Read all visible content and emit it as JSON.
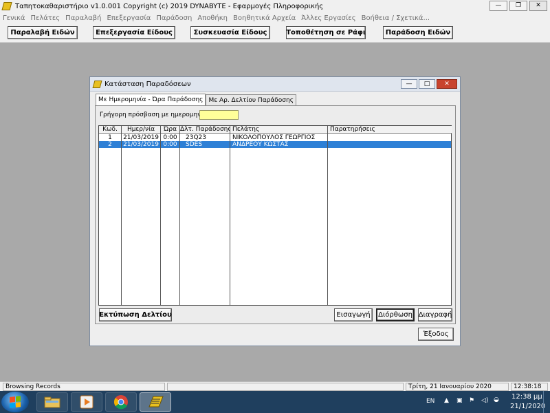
{
  "window": {
    "title": "Ταπητοκαθαριστήριο v1.0.001    Copyright (c) 2019  DYNABYTE - Εφαρμογές Πληροφορικής",
    "minimize": "—",
    "maximize": "❐",
    "close": "✕"
  },
  "menu": [
    "Γενικά",
    "Πελάτες",
    "Παραλαβή",
    "Επεξεργασία",
    "Παράδοση",
    "Αποθήκη",
    "Βοηθητικά Αρχεία",
    "Άλλες Εργασίες",
    "Βοήθεια / Σχετικά..."
  ],
  "toolbar": {
    "receive": "Παραλαβή Ειδών",
    "process": "Επεξεργασία Είδους",
    "package": "Συσκευασία Είδους",
    "shelve": "Τοποθέτηση σε Ράφι",
    "deliver": "Παράδοση Ειδών"
  },
  "dialog": {
    "title": "Κατάσταση Παραδόσεων",
    "minimize": "—",
    "maximize": "□",
    "close": "✕",
    "tabs": [
      "Με Ημερομηνία - Ώρα Παράδοσης",
      "Με Αρ. Δελτίου Παράδοσης"
    ],
    "quick_access_label": "Γρήγορη πρόσβαση με ημερομηνία :",
    "quick_access_value": "",
    "columns": [
      "Κωδ.",
      "Ημερ/νία",
      "Ώρα",
      "Δλτ. Παράδοσης",
      "Πελάτης",
      "Παρατηρήσεις"
    ],
    "rows": [
      {
        "code": "1",
        "date": "21/03/2019",
        "time": "0:00",
        "slip": "23Q23",
        "customer": "ΝΙΚΟΛΟΠΟΥΛΟΣ ΓΕΩΡΓΙΟΣ",
        "notes": ""
      },
      {
        "code": "2",
        "date": "21/03/2019",
        "time": "0:00",
        "slip": "SDES",
        "customer": "ΑΝΔΡΕΟΥ ΚΩΣΤΑΣ",
        "notes": ""
      }
    ],
    "selected_row": 2,
    "buttons": {
      "print": "Εκτύπωση Δελτίου",
      "insert": "Εισαγωγή",
      "edit": "Διόρθωση",
      "delete": "Διαγραφή",
      "exit": "Έξοδος"
    }
  },
  "status": {
    "mode": "Browsing Records",
    "date": "Τρίτη, 21 Ιανουαρίου 2020",
    "time": "12:38:18"
  },
  "taskbar": {
    "apps": [
      "explorer-icon",
      "media-player-icon",
      "chrome-icon",
      "app-icon"
    ],
    "lang": "EN",
    "clock_time": "12:38 μμ",
    "clock_date": "21/1/2020"
  },
  "colors": {
    "desktop_bg": "#a9a9a9",
    "selection": "#2e80d6",
    "quick_input_bg": "#ffff99",
    "taskbar": "#1f3f5e"
  }
}
